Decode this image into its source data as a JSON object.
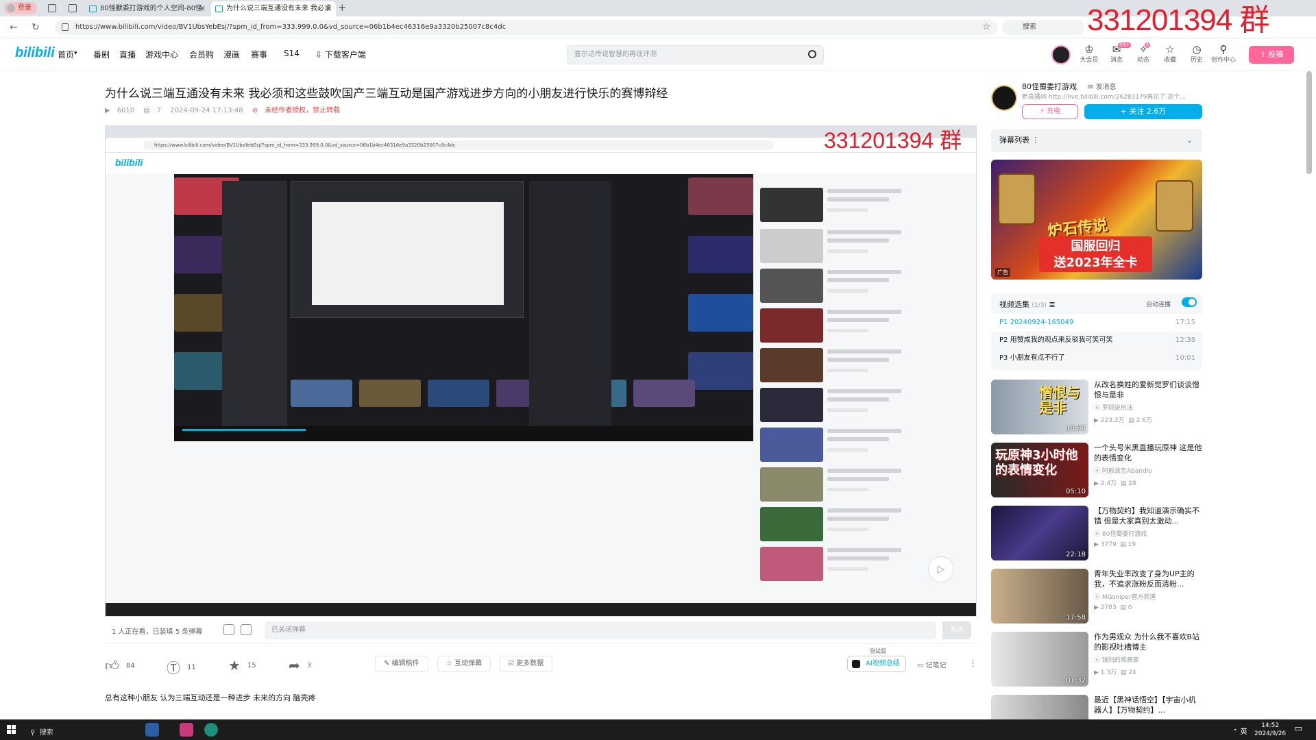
{
  "browser": {
    "login": "登录",
    "tabs": [
      {
        "title": "80怪獸委打游戏的个人空间-80怪"
      },
      {
        "title": "为什么说三端互通没有未来 我必须"
      }
    ],
    "url": "https://www.bilibili.com/video/BV1UbsYebEsj/?spm_id_from=333.999.0.0&vd_source=06b1b4ec46316e9a3320b25007c8c4dc",
    "search_placeholder": "搜索"
  },
  "overlay_text": "331201394 群",
  "header": {
    "logo": "bilibili",
    "nav": [
      "首页",
      "番剧",
      "直播",
      "游戏中心",
      "会员购",
      "漫画",
      "赛事",
      "S14"
    ],
    "download": "下载客户端",
    "search_placeholder": "塞尔达传说智慧的再现评测",
    "icons": [
      {
        "label": "大会员",
        "icon": "vip-icon"
      },
      {
        "label": "消息",
        "icon": "message-icon",
        "badge": "99+"
      },
      {
        "label": "动态",
        "icon": "dynamic-icon",
        "badge": "6"
      },
      {
        "label": "收藏",
        "icon": "star-icon"
      },
      {
        "label": "历史",
        "icon": "history-icon"
      },
      {
        "label": "创作中心",
        "icon": "creator-icon"
      }
    ],
    "upload": "投稿"
  },
  "video": {
    "title": "为什么说三端互通没有未来 我必须和这些鼓吹国产三端互动是国产游戏进步方向的小朋友进行快乐的赛博辩经",
    "views": "6010",
    "danmaku": "7",
    "date": "2024-09-24 17:13:48",
    "rights": "未经作者授权，禁止转载",
    "inner_overlay": "331201394 群"
  },
  "danmaku_bar": {
    "watching": "1 人正在看，已装填 5 条弹幕",
    "placeholder": "已关闭弹幕",
    "send": "发送"
  },
  "toolbar": {
    "like": "84",
    "coin": "11",
    "fav": "15",
    "share": "3",
    "edit": "编辑稿件",
    "interactive": "互动弹幕",
    "more_data": "更多数据",
    "ai_summary": "AI视频总结",
    "test_tag": "测试版",
    "notes": "记笔记"
  },
  "description": "总有这种小朋友 认为三端互动还是一种进步 未来的方向 脑壳疼",
  "uploader": {
    "name": "80怪蜀委打游戏",
    "msg": "发消息",
    "desc": "新直播间 http://live.bilibili.com/26283179再见了 这个...",
    "charge": "充电",
    "follow": "关注 2.6万"
  },
  "dm_list": "弹幕列表",
  "ad": {
    "line1": "炉石传说",
    "line2a": "国服回归",
    "line2b": "送2023年全卡",
    "tag": "广告"
  },
  "playlist": {
    "title": "视频选集",
    "count": "(1/3)",
    "autoplay": "自动连播",
    "items": [
      {
        "title": "P1  20240924-165049",
        "dur": "17:15"
      },
      {
        "title": "P2  用赞成我的观点来反驳我可笑可笑",
        "dur": "12:38"
      },
      {
        "title": "P3  小朋友有点不行了",
        "dur": "10:01"
      }
    ]
  },
  "recommend": [
    {
      "title": "从改名换姓的爱新觉罗们谈谈憎恨与是非",
      "author": "罗翔说刑法",
      "views": "223.2万",
      "dm": "2.6万",
      "dur": "10:53",
      "thumb_text": "憎恨与是非"
    },
    {
      "title": "一个头号米黑直播玩原神 这是他的表情变化",
      "author": "阿般波吉Abandlo",
      "views": "2.4万",
      "dm": "28",
      "dur": "05:10",
      "thumb_text": "玩原神3小时他的表情变化"
    },
    {
      "title": "【万物契约】我知道演示确实不错 但是大家真别太激动...",
      "author": "80怪蜀委打游戏",
      "views": "3779",
      "dm": "19",
      "dur": "22:18",
      "thumb_text": ""
    },
    {
      "title": "青年失业率改变了身为UP主的我，不追求涨粉反而清粉...",
      "author": "MGsniper官方频道",
      "views": "2783",
      "dm": "0",
      "dur": "17:58",
      "thumb_text": ""
    },
    {
      "title": "作为男观众 为什么我不喜欢B站的影视吐槽博主",
      "author": "锐利的观察家",
      "views": "1.3万",
      "dm": "24",
      "dur": "01:32",
      "thumb_text": ""
    },
    {
      "title": "最近【黑神话悟空】【宇宙小机器人】【万物契约】...",
      "author": "",
      "views": "",
      "dm": "",
      "dur": "",
      "thumb_text": ""
    }
  ],
  "taskbar": {
    "search": "搜索",
    "ime": "英",
    "time": "14:52",
    "date": "2024/9/26"
  }
}
